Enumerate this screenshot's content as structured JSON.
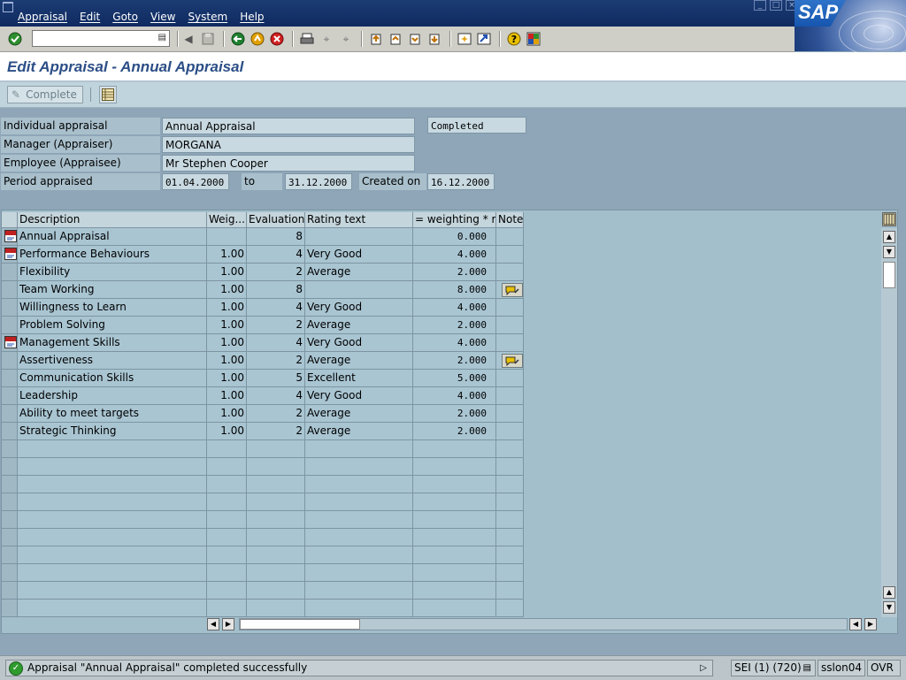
{
  "menu": [
    "Appraisal",
    "Edit",
    "Goto",
    "View",
    "System",
    "Help"
  ],
  "brand": "SAP",
  "colors": {
    "title": "#2b4e86",
    "menubar": "#1c3c74",
    "table_bg": "#a9c5d2",
    "status_ok": "#2e9b2e"
  },
  "toolbar": {
    "icons": [
      "enter-icon",
      "back-icon",
      "exit-icon",
      "cancel-icon",
      "print-icon",
      "find-icon",
      "find-next-icon",
      "first-page-icon",
      "previous-page-icon",
      "next-page-icon",
      "last-page-icon",
      "create-session-icon",
      "shortcut-icon",
      "help-icon",
      "layout-icon"
    ]
  },
  "page": {
    "title": "Edit Appraisal - Annual Appraisal",
    "complete_label": "Complete"
  },
  "header": {
    "individual_label": "Individual appraisal",
    "individual_value": "Annual Appraisal",
    "status_value": "Completed",
    "manager_label": "Manager (Appraiser)",
    "manager_value": "MORGANA",
    "employee_label": "Employee (Appraisee)",
    "employee_value": "Mr Stephen Cooper",
    "period_label": "Period appraised",
    "period_from": "01.04.2000",
    "to_label": "to",
    "period_to": "31.12.2000",
    "created_label": "Created on",
    "created_value": "16.12.2000"
  },
  "table": {
    "columns": [
      "Description",
      "Weig...",
      "Evaluation",
      "Rating text",
      "= weighting * r...",
      "Note"
    ],
    "rows": [
      {
        "description": "Annual Appraisal",
        "weight": "",
        "evaluation": "8",
        "rating": "",
        "result": "0.000",
        "node": true,
        "note": false
      },
      {
        "description": "Performance Behaviours",
        "weight": "1.00",
        "evaluation": "4",
        "rating": "Very Good",
        "result": "4.000",
        "node": true,
        "note": false
      },
      {
        "description": "Flexibility",
        "weight": "1.00",
        "evaluation": "2",
        "rating": "Average",
        "result": "2.000",
        "node": false,
        "note": false
      },
      {
        "description": "Team Working",
        "weight": "1.00",
        "evaluation": "8",
        "rating": "",
        "result": "8.000",
        "node": false,
        "note": true
      },
      {
        "description": "Willingness to Learn",
        "weight": "1.00",
        "evaluation": "4",
        "rating": "Very Good",
        "result": "4.000",
        "node": false,
        "note": false
      },
      {
        "description": "Problem Solving",
        "weight": "1.00",
        "evaluation": "2",
        "rating": "Average",
        "result": "2.000",
        "node": false,
        "note": false
      },
      {
        "description": "Management Skills",
        "weight": "1.00",
        "evaluation": "4",
        "rating": "Very Good",
        "result": "4.000",
        "node": true,
        "note": false
      },
      {
        "description": "Assertiveness",
        "weight": "1.00",
        "evaluation": "2",
        "rating": "Average",
        "result": "2.000",
        "node": false,
        "note": true
      },
      {
        "description": "Communication Skills",
        "weight": "1.00",
        "evaluation": "5",
        "rating": "Excellent",
        "result": "5.000",
        "node": false,
        "note": false
      },
      {
        "description": "Leadership",
        "weight": "1.00",
        "evaluation": "4",
        "rating": "Very Good",
        "result": "4.000",
        "node": false,
        "note": false
      },
      {
        "description": "Ability to meet targets",
        "weight": "1.00",
        "evaluation": "2",
        "rating": "Average",
        "result": "2.000",
        "node": false,
        "note": false
      },
      {
        "description": "Strategic Thinking",
        "weight": "1.00",
        "evaluation": "2",
        "rating": "Average",
        "result": "2.000",
        "node": false,
        "note": false
      }
    ],
    "empty_rows": 10
  },
  "status": {
    "message": "Appraisal \"Annual Appraisal\" completed successfully",
    "session": "SEI (1) (720)",
    "server": "sslon04",
    "mode": "OVR"
  }
}
